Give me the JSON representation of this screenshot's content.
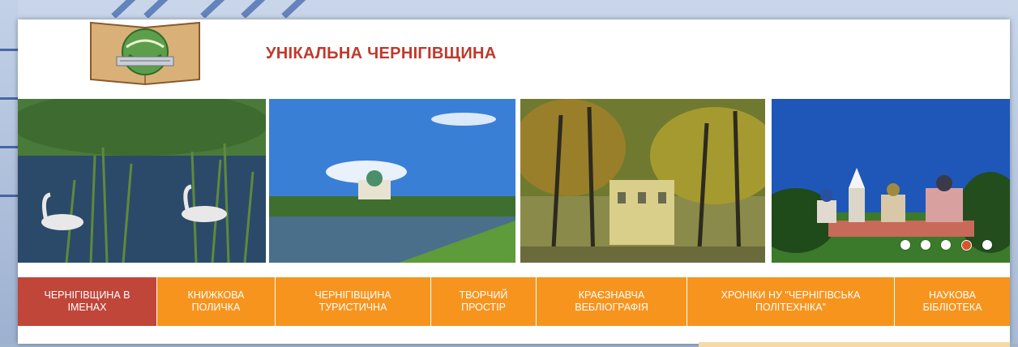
{
  "site": {
    "title": "УНІКАЛЬНА ЧЕРНІГІВЩИНА",
    "logo_icon": "library-book-globe-logo"
  },
  "slider": {
    "slides": [
      {
        "name": "swans-lake-slide"
      },
      {
        "name": "river-monastery-slide"
      },
      {
        "name": "autumn-park-slide"
      },
      {
        "name": "cathedral-slide"
      }
    ],
    "dots": [
      false,
      false,
      false,
      true,
      false
    ]
  },
  "nav": {
    "items": [
      {
        "label": "ЧЕРНІГІВЩИНА В ІМЕНАХ",
        "active": true
      },
      {
        "label": "КНИЖКОВА ПОЛИЧКА",
        "active": false
      },
      {
        "label": "ЧЕРНІГІВЩИНА ТУРИСТИЧНА",
        "active": false
      },
      {
        "label": "ТВОРЧИЙ ПРОСТІР",
        "active": false
      },
      {
        "label": "КРАЄЗНАВЧА ВЕБЛІОГРАФІЯ",
        "active": false
      },
      {
        "label": "ХРОНІКИ НУ \"ЧЕРНІГІВСЬКА ПОЛІТЕХНІКА\"",
        "active": false
      },
      {
        "label": "НАУКОВА БІБЛІОТЕКА",
        "active": false
      }
    ]
  },
  "colors": {
    "accent": "#f7941d",
    "active": "#c0463a",
    "title": "#c0392b"
  }
}
